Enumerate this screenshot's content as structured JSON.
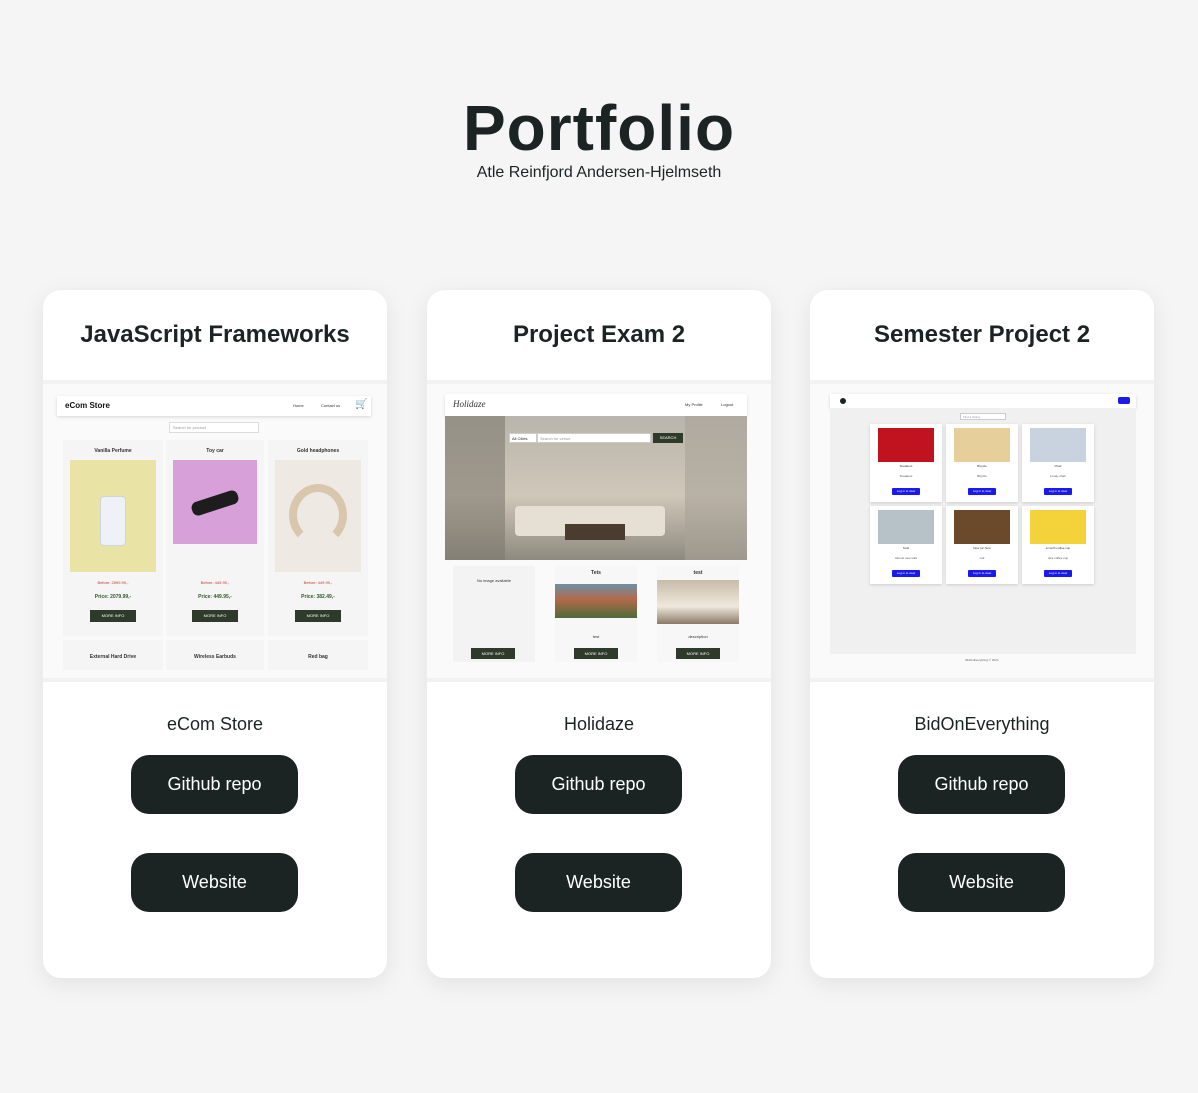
{
  "header": {
    "title": "Portfolio",
    "subtitle": "Atle Reinfjord Andersen-Hjelmseth"
  },
  "cards": [
    {
      "heading": "JavaScript Frameworks",
      "project": "eCom Store",
      "repo_label": "Github repo",
      "site_label": "Website",
      "preview": {
        "brand": "eCom Store",
        "nav": [
          "Home",
          "Contact us"
        ],
        "search_placeholder": "Search for product",
        "products": [
          {
            "name": "Vanilla Perfume",
            "before": "Before: 2599.99,-",
            "price": "Price: 2079.99,-",
            "cta": "MORE INFO",
            "color": "#e9e4a6"
          },
          {
            "name": "Toy car",
            "before": "Before: 449.99,-",
            "price": "Price: 449.95,-",
            "cta": "MORE INFO",
            "color": "#d7a0d8"
          },
          {
            "name": "Gold headphones",
            "before": "Before: 449.99,-",
            "price": "Price: 382.49,-",
            "cta": "MORE INFO",
            "color": "#efe9e3"
          }
        ],
        "more": [
          "External Hard Drive",
          "Wireless Earbuds",
          "Red bag"
        ]
      }
    },
    {
      "heading": "Project Exam 2",
      "project": "Holidaze",
      "repo_label": "Github repo",
      "site_label": "Website",
      "preview": {
        "brand": "Holidaze",
        "nav": [
          "My Profile",
          "Logout"
        ],
        "filter": "All Cities",
        "search_placeholder": "Search for venue",
        "search_button": "SEARCH",
        "venues": [
          {
            "name": "",
            "desc": "No image available",
            "cta": "MORE INFO"
          },
          {
            "name": "Tets",
            "desc": "test",
            "cta": "MORE INFO"
          },
          {
            "name": "test",
            "desc": "description",
            "cta": "MORE INFO"
          }
        ]
      }
    },
    {
      "heading": "Semester Project 2",
      "project": "BidOnEverything",
      "repo_label": "Github repo",
      "site_label": "Website",
      "preview": {
        "search_placeholder": "Find a listing...",
        "listings": [
          {
            "name": "Sneakers",
            "desc": "Sneakers",
            "cta": "Log in to view",
            "color": "#c1121f"
          },
          {
            "name": "Bicycle",
            "desc": "Bicycle",
            "cta": "Log in to view",
            "color": "#e6cf9a"
          },
          {
            "name": "Chair",
            "desc": "Lovely chair",
            "cta": "Log in to view",
            "color": "#c9d3e0"
          },
          {
            "name": "Sofa",
            "desc": "Almost new sofa",
            "cta": "Log in to view",
            "color": "#b7c2c8"
          },
          {
            "name": "New pic here",
            "desc": "null",
            "cta": "Log in to view",
            "color": "#6b4a2b"
          },
          {
            "name": "smooth coffee cup",
            "desc": "nice coffee cup",
            "cta": "Log in to view",
            "color": "#f3d23a"
          }
        ],
        "footer": "BidOnEverything © 2024"
      }
    }
  ]
}
